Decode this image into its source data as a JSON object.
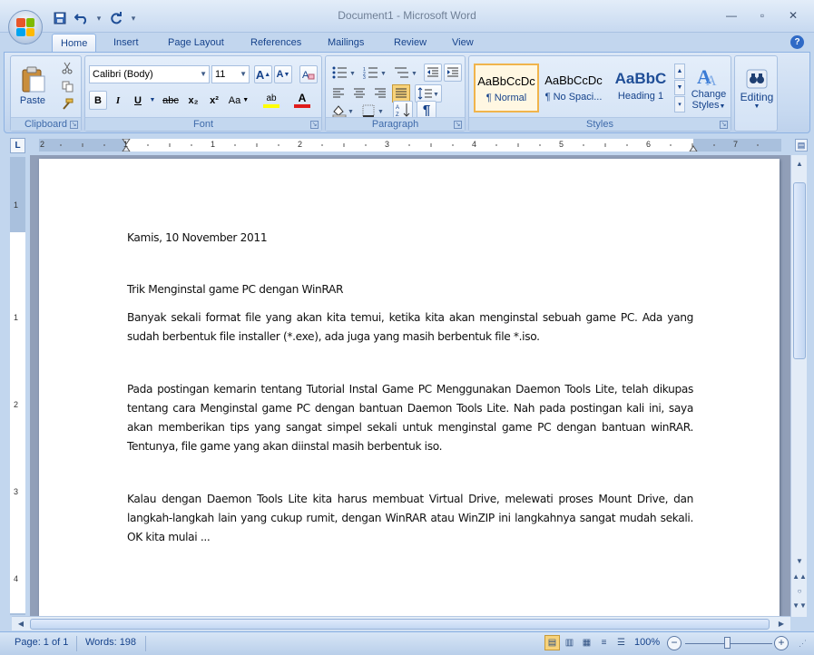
{
  "window": {
    "title": "Document1 - Microsoft Word",
    "minimize": "—",
    "restore": "▫",
    "close": "✕"
  },
  "qat": {
    "save_icon": "save-icon",
    "undo_icon": "undo-icon",
    "redo_icon": "redo-icon",
    "customize": "▾"
  },
  "tabs": [
    "Home",
    "Insert",
    "Page Layout",
    "References",
    "Mailings",
    "Review",
    "View"
  ],
  "active_tab": "Home",
  "clipboard": {
    "label": "Clipboard",
    "paste": "Paste"
  },
  "font": {
    "label": "Font",
    "family": "Calibri (Body)",
    "size": "11",
    "bold": "B",
    "italic": "I",
    "underline": "U",
    "strike": "abc",
    "subscript": "x₂",
    "superscript": "x²",
    "change_case": "Aa",
    "grow": "A",
    "shrink": "A",
    "highlight": "ab",
    "color": "A"
  },
  "paragraph": {
    "label": "Paragraph",
    "show_marks": "¶"
  },
  "styles": {
    "label": "Styles",
    "tiles": [
      {
        "sample": "AaBbCcDc",
        "name": "¶ Normal"
      },
      {
        "sample": "AaBbCcDc",
        "name": "¶ No Spaci..."
      },
      {
        "sample": "AaBbC",
        "name": "Heading 1"
      }
    ],
    "change_styles": "Change Styles",
    "change_styles_line1": "Change",
    "change_styles_line2": "Styles"
  },
  "editing": {
    "label": "Editing"
  },
  "ruler": {
    "h_numbers": [
      "2",
      "1",
      "1",
      "2",
      "3",
      "4",
      "5",
      "6",
      "7"
    ],
    "v_numbers": [
      "1",
      "1",
      "2",
      "3",
      "4"
    ]
  },
  "document": {
    "date_line": "Kamis, 10 November 2011",
    "heading": "Trik Menginstal game PC dengan WinRAR",
    "paragraphs": [
      "Banyak sekali format file yang akan kita temui, ketika kita akan menginstal sebuah game PC. Ada yang sudah berbentuk file installer (*.exe), ada juga yang masih berbentuk file *.iso.",
      "Pada postingan kemarin tentang Tutorial Instal Game PC Menggunakan Daemon Tools Lite, telah dikupas tentang cara Menginstal game PC dengan bantuan Daemon Tools Lite. Nah pada postingan kali ini, saya akan memberikan tips yang sangat simpel sekali untuk menginstal game PC dengan bantuan winRAR. Tentunya, file game yang akan diinstal masih berbentuk iso.",
      "Kalau dengan Daemon Tools Lite kita harus membuat Virtual Drive, melewati proses Mount Drive, dan langkah-langkah lain yang cukup rumit, dengan WinRAR atau WinZIP ini langkahnya sangat mudah sekali. OK kita mulai ..."
    ]
  },
  "status": {
    "page": "Page: 1 of 1",
    "words": "Words: 198",
    "zoom": "100%",
    "zoom_out": "−",
    "zoom_in": "+"
  }
}
